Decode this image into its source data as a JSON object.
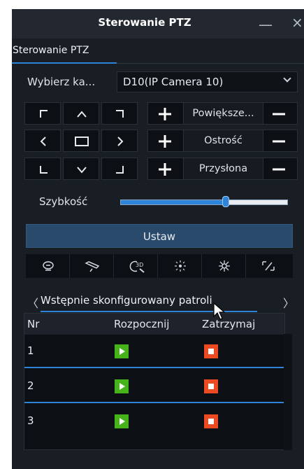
{
  "window": {
    "title": "Sterowanie PTZ",
    "minimize_glyph": "—",
    "close_glyph": "×"
  },
  "tabs": {
    "active": "Sterowanie PTZ"
  },
  "camera": {
    "label": "Wybierz ka...",
    "selected": "D10(IP Camera 10)"
  },
  "lens": {
    "zoom_label": "Powiększe...",
    "focus_label": "Ostrość",
    "iris_label": "Przysłona"
  },
  "speed": {
    "label": "Szybkość",
    "level": 0.63
  },
  "set_button": "Ustaw",
  "function_icons": [
    "wiper-icon",
    "light-icon",
    "3d-zoom-icon",
    "auto-focus-icon",
    "defog-icon",
    "lens-init-icon"
  ],
  "patrol": {
    "prev_glyph": "〈",
    "next_glyph": "〉",
    "tab_label": "Wstępnie skonfigurowany patroli",
    "columns": [
      "Nr",
      "Rozpocznij",
      "Zatrzymaj"
    ],
    "rows": [
      "1",
      "2",
      "3"
    ]
  },
  "colors": {
    "accent": "#2e84d8",
    "start": "#46b31a",
    "stop": "#ec4a23"
  }
}
